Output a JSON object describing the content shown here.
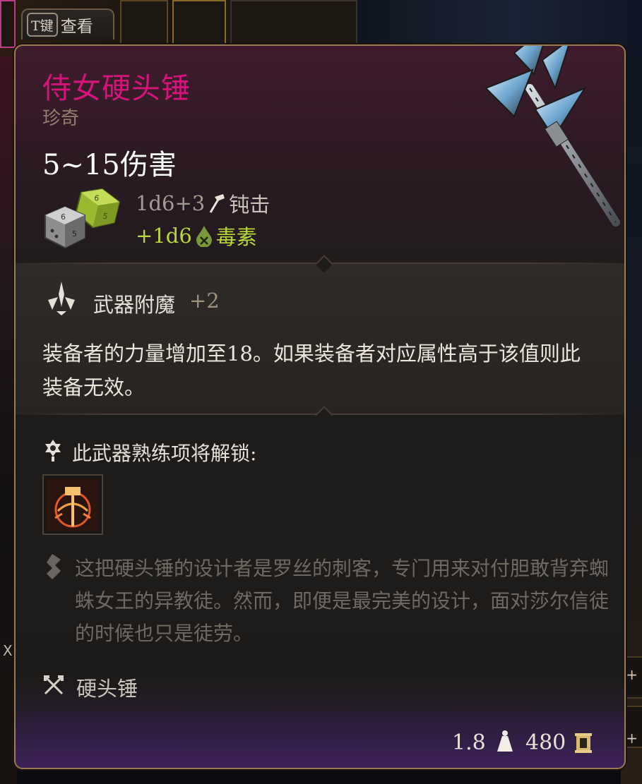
{
  "hint": {
    "key": "T键",
    "label": "查看"
  },
  "item": {
    "name": "侍女硬头锤",
    "rarity": "珍奇",
    "damage": "5~15伤害",
    "damage_lines": [
      {
        "dice": "1d6+3",
        "icon": "blunt-hammer-icon",
        "type": "钝击"
      },
      {
        "dice": "+1d6",
        "icon": "poison-drop-icon",
        "type": "毒素"
      }
    ]
  },
  "enchantment": {
    "title": "武器附魔",
    "bonus": "+2",
    "description": "装备者的力量增加至18。如果装备者对应属性高于该值则此装备无效。"
  },
  "proficiency": {
    "title": "此武器熟练项将解锁:",
    "action_icon": "weapon-action-icon"
  },
  "lore": "这把硬头锤的设计者是罗丝的刺客，专门用来对付胆敢背弃蜘蛛女王的异教徒。然而，即便是最完美的设计，面对莎尔信徒的时候也只是徒劳。",
  "weapon_type": "硬头锤",
  "footer": {
    "weight": "1.8",
    "price": "480"
  },
  "colors": {
    "item_name": "#d4147a",
    "poison": "#b9d83a",
    "panel_border": "#9c7a52"
  }
}
